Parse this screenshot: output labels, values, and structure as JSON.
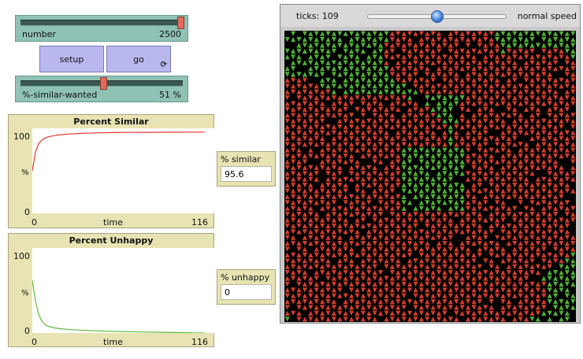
{
  "sliders": {
    "number": {
      "label": "number",
      "value": "2500",
      "fraction": 1.0
    },
    "similar_wanted": {
      "label": "%-similar-wanted",
      "value": "51 %",
      "fraction": 0.51
    }
  },
  "buttons": {
    "setup": "setup",
    "go": "go",
    "go_forever_icon": "forever-arrows-icon"
  },
  "plots": {
    "similar": {
      "title": "Percent Similar",
      "y_max": "100",
      "y_min": "0",
      "ylabel": "%",
      "x_min": "0",
      "x_max": "116",
      "xlabel": "time"
    },
    "unhappy": {
      "title": "Percent Unhappy",
      "y_max": "100",
      "y_min": "0",
      "ylabel": "%",
      "x_min": "0",
      "x_max": "116",
      "xlabel": "time"
    }
  },
  "monitors": {
    "similar": {
      "label": "% similar",
      "value": "95.6"
    },
    "unhappy": {
      "label": "% unhappy",
      "value": "0"
    }
  },
  "view": {
    "ticks_label": "ticks: 109",
    "speed_label": "normal speed",
    "speed_fraction": 0.5
  },
  "chart_data": [
    {
      "type": "line",
      "title": "Percent Similar",
      "xlabel": "time",
      "ylabel": "%",
      "xlim": [
        0,
        116
      ],
      "ylim": [
        0,
        100
      ],
      "series": [
        {
          "color": "#e0372c",
          "x": [
            0,
            2,
            4,
            6,
            8,
            10,
            14,
            18,
            24,
            30,
            40,
            50,
            60,
            70,
            80,
            90,
            100,
            109
          ],
          "y": [
            50,
            72,
            82,
            86,
            88.5,
            90,
            91.5,
            92.5,
            93.3,
            94,
            94.6,
            95,
            95.2,
            95.3,
            95.4,
            95.5,
            95.6,
            95.6
          ]
        }
      ]
    },
    {
      "type": "line",
      "title": "Percent Unhappy",
      "xlabel": "time",
      "ylabel": "%",
      "xlim": [
        0,
        116
      ],
      "ylim": [
        0,
        100
      ],
      "series": [
        {
          "color": "#5dbb3a",
          "x": [
            0,
            2,
            4,
            6,
            8,
            10,
            14,
            18,
            24,
            30,
            40,
            50,
            60,
            70,
            80,
            90,
            100,
            109
          ],
          "y": [
            62,
            38,
            22,
            14,
            10,
            8,
            6,
            5,
            4,
            3.4,
            2.6,
            2,
            1.6,
            1.2,
            0.9,
            0.6,
            0.3,
            0
          ]
        }
      ]
    }
  ],
  "world": {
    "red": "#d53b2c",
    "green": "#4fae35",
    "background": "#000000"
  }
}
